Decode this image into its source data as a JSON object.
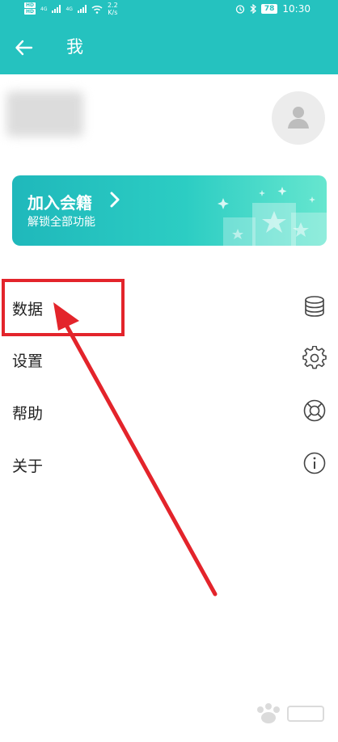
{
  "status_bar": {
    "hd_badges": [
      "HD",
      "HD"
    ],
    "network": [
      "4G",
      "4G"
    ],
    "speed_value": "2.2",
    "speed_unit": "K/s",
    "battery": "78",
    "time": "10:30",
    "icons": [
      "alarm-icon",
      "bluetooth-icon",
      "wifi-icon",
      "signal-icon"
    ]
  },
  "app_bar": {
    "title": "我"
  },
  "member_card": {
    "title": "加入会籍",
    "subtitle": "解锁全部功能"
  },
  "menu": {
    "items": [
      {
        "label": "数据",
        "icon": "database-icon"
      },
      {
        "label": "设置",
        "icon": "gear-icon"
      },
      {
        "label": "帮助",
        "icon": "lifebuoy-icon"
      },
      {
        "label": "关于",
        "icon": "info-icon"
      }
    ]
  },
  "colors": {
    "header": "#25c2bf",
    "annotation": "#e3242b"
  }
}
